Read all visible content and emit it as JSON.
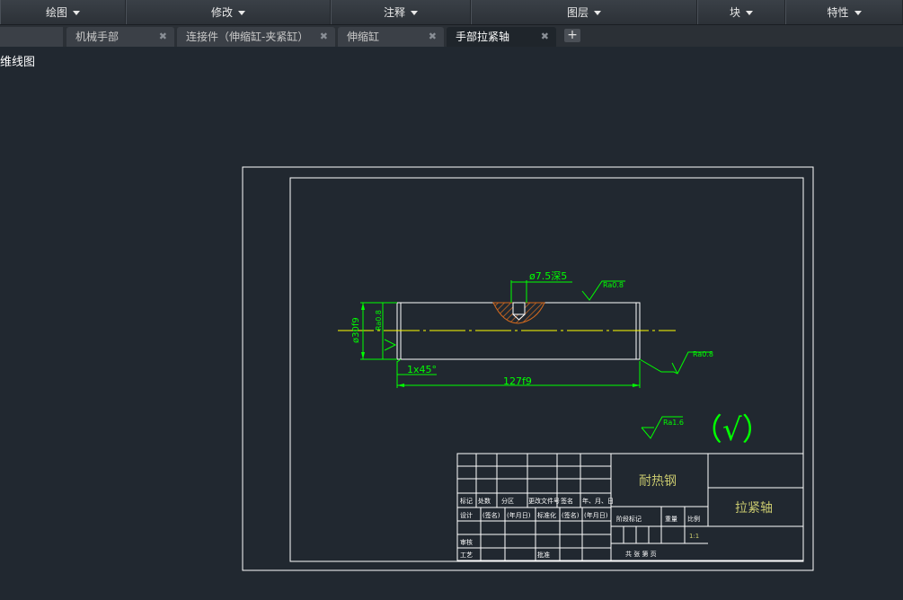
{
  "ribbon": {
    "panels": [
      {
        "label": "绘图"
      },
      {
        "label": "修改"
      },
      {
        "label": "注释"
      },
      {
        "label": "图层"
      },
      {
        "label": "块"
      },
      {
        "label": "特性"
      }
    ]
  },
  "tabs": [
    {
      "label": "机械手部",
      "close": "✖"
    },
    {
      "label": "连接件（伸缩缸-夹紧缸）",
      "close": "✖"
    },
    {
      "label": "伸缩缸",
      "close": "✖"
    },
    {
      "label": "手部拉紧轴",
      "close": "✖"
    }
  ],
  "new_tab": "+",
  "view_label": "维线图",
  "drawing": {
    "dim_hole": "ø7.5深5",
    "dim_diameter": "ø30f9",
    "dim_inner": "Ra0.8",
    "dim_chamfer": "1x45°",
    "dim_length": "127f9",
    "roughness_top": "Ra0.8",
    "roughness_right": "Ra0.8",
    "roughness_general": "Ra1.6",
    "general_mark": "（√）"
  },
  "title_block": {
    "material": "耐热钢",
    "part_name": "拉紧轴",
    "row_headers": [
      "标记",
      "处数",
      "分区",
      "更改文件号",
      "签名",
      "年、月、日"
    ],
    "row_design": [
      "设计",
      "(签名)",
      "(年月日)",
      "标准化",
      "(签名)",
      "(年月日)"
    ],
    "stage_headers": [
      "阶段标记",
      "重量",
      "比例"
    ],
    "scale": "1:1",
    "sheet_info": "共 张 第 页",
    "review": "审核",
    "process": "工艺",
    "approve": "批准"
  },
  "colors": {
    "background": "#212830",
    "frame": "#ffffff",
    "dimension": "#00ff00",
    "centerline": "#ffff00",
    "hatch": "#d2691e",
    "table_text": "#c8c86e"
  }
}
